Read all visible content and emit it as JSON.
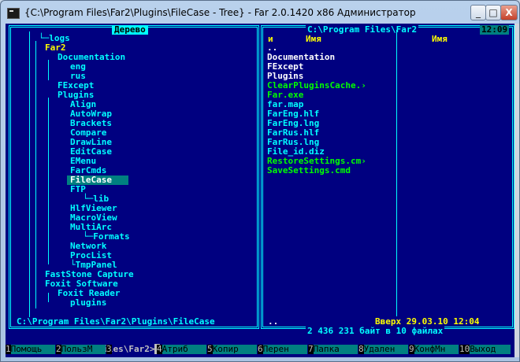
{
  "window": {
    "title": "{C:\\Program Files\\Far2\\Plugins\\FileCase - Tree} - Far 2.0.1420 x86 Администратор",
    "min": "_",
    "max": "□",
    "close": "X"
  },
  "left_panel": {
    "header": "Дерево",
    "items": [
      "└─logs",
      "Far2",
      "Documentation",
      "eng",
      "rus",
      "FExcept",
      "Plugins",
      "Align",
      "AutoWrap",
      "Brackets",
      "Compare",
      "DrawLine",
      "EditCase",
      "EMenu",
      "FarCmds",
      "FileCase",
      "FTP",
      "└─lib",
      "HlfViewer",
      "MacroView",
      "MultiArc",
      "└─Formats",
      "Network",
      "ProcList",
      "└TmpPanel",
      "FastStone Capture",
      "Foxit Software",
      "Foxit Reader",
      "plugins"
    ],
    "path": "C:\\Program Files\\Far2\\Plugins\\FileCase"
  },
  "right_panel": {
    "path_title": "C:\\Program Files\\Far2",
    "clock": "12:09",
    "col_marker": "и",
    "col1": "Имя",
    "col2": "Имя",
    "files": [
      {
        "name": "..",
        "color": "#ffffff"
      },
      {
        "name": "Documentation",
        "color": "#ffffff"
      },
      {
        "name": "FExcept",
        "color": "#ffffff"
      },
      {
        "name": "Plugins",
        "color": "#ffffff"
      },
      {
        "name": "ClearPluginsCache.›",
        "color": "#00ff00"
      },
      {
        "name": "Far.exe",
        "color": "#00ff00"
      },
      {
        "name": "far.map",
        "color": "#00ffff"
      },
      {
        "name": "FarEng.hlf",
        "color": "#00ffff"
      },
      {
        "name": "FarEng.lng",
        "color": "#00ffff"
      },
      {
        "name": "FarRus.hlf",
        "color": "#00ffff"
      },
      {
        "name": "FarRus.lng",
        "color": "#00ffff"
      },
      {
        "name": "File_id.diz",
        "color": "#00ffff"
      },
      {
        "name": "RestoreSettings.cm›",
        "color": "#00ff00"
      },
      {
        "name": "SaveSettings.cmd",
        "color": "#00ff00"
      }
    ],
    "status_left": "..",
    "status_right": "Вверх 29.03.10 12:04",
    "summary": "2 436 231 байт в 10 файлах"
  },
  "cmdline": "C:\\Program Files\\Far2>",
  "fkeys": [
    {
      "num": "1",
      "label": "Помощь"
    },
    {
      "num": "2",
      "label": "ПользМ"
    },
    {
      "num": "3",
      "label": ""
    },
    {
      "num": "4",
      "label": "Атриб"
    },
    {
      "num": "5",
      "label": "Копир"
    },
    {
      "num": "6",
      "label": "Перен"
    },
    {
      "num": "7",
      "label": "Папка"
    },
    {
      "num": "8",
      "label": "Удален"
    },
    {
      "num": "9",
      "label": "КонфМн"
    },
    {
      "num": "10",
      "label": "Выход"
    }
  ],
  "colors": {
    "background": "#000080",
    "frame": "#00ffff",
    "highlight": "#008080",
    "folder": "#ffffff",
    "exe": "#00ff00",
    "file": "#00ffff",
    "header": "#ffff00"
  }
}
